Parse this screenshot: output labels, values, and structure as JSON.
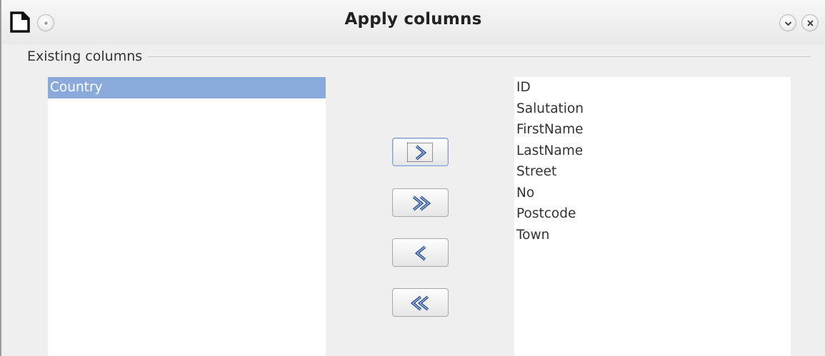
{
  "window": {
    "title": "Apply columns"
  },
  "icons": {
    "app": "document-icon",
    "menu": "window-menu-icon",
    "minimize": "chevron-down-icon",
    "close": "close-icon"
  },
  "group": {
    "label": "Existing columns"
  },
  "available_columns": {
    "items": [
      "Country"
    ],
    "selected": "Country"
  },
  "applied_columns": {
    "items": [
      "ID",
      "Salutation",
      "FirstName",
      "LastName",
      "Street",
      "No",
      "Postcode",
      "Town"
    ]
  },
  "buttons": {
    "add_one": "add-one-icon",
    "add_all": "add-all-icon",
    "remove_one": "remove-one-icon",
    "remove_all": "remove-all-icon",
    "focused": "add_one"
  },
  "colors": {
    "selection": "#8aaadb",
    "arrow": "#2a4f8c",
    "window_bg": "#efefef",
    "list_bg": "#ffffff"
  }
}
